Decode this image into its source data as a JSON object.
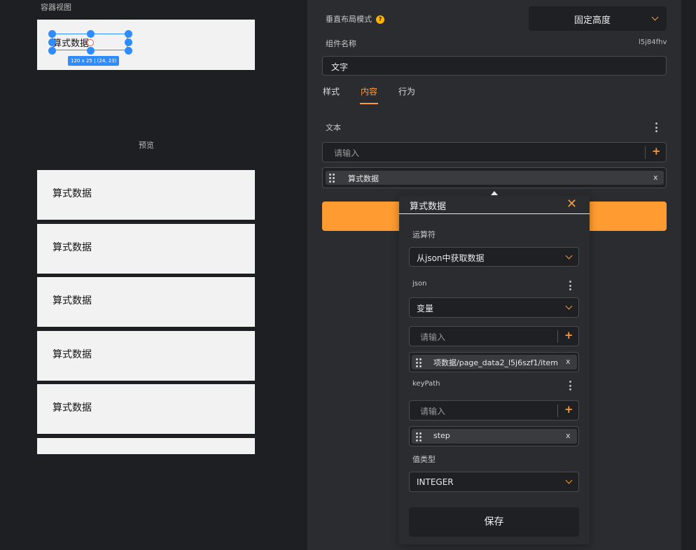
{
  "canvas": {
    "container_view_label": "容器视图",
    "selected_text": "算式数据",
    "size_tag": "120 x 25 | (24, 23)",
    "preview_label": "预览",
    "cards": [
      "算式数据",
      "算式数据",
      "算式数据",
      "算式数据",
      "算式数据",
      ""
    ]
  },
  "panel": {
    "layout_mode_label": "垂直布局模式",
    "help_glyph": "?",
    "layout_mode_value": "固定高度",
    "component_name_label": "组件名称",
    "component_id": "l5j84fhv",
    "component_name_value": "文字",
    "tabs": [
      {
        "label": "样式",
        "active": false
      },
      {
        "label": "内容",
        "active": true
      },
      {
        "label": "行为",
        "active": false
      }
    ],
    "text_label": "文本",
    "text_input_placeholder": "请输入",
    "text_chip": "算式数据",
    "chip_close": "x",
    "plus": "+"
  },
  "popup": {
    "title": "算式数据",
    "close": "✕",
    "operator_label": "运算符",
    "operator_value": "从json中获取数据",
    "json_label": "json",
    "json_type": "变量",
    "json_placeholder": "请输入",
    "json_chip": "项数据/page_data2_l5j6szf1/item",
    "keypath_label": "keyPath",
    "keypath_placeholder": "请输入",
    "keypath_chip": "step",
    "value_type_label": "值类型",
    "value_type": "INTEGER",
    "save": "保存"
  },
  "colors": {
    "accent": "#ff9b30",
    "selection": "#2f8cff",
    "panel_bg": "#2b2c2f",
    "app_bg": "#1e1f22"
  }
}
